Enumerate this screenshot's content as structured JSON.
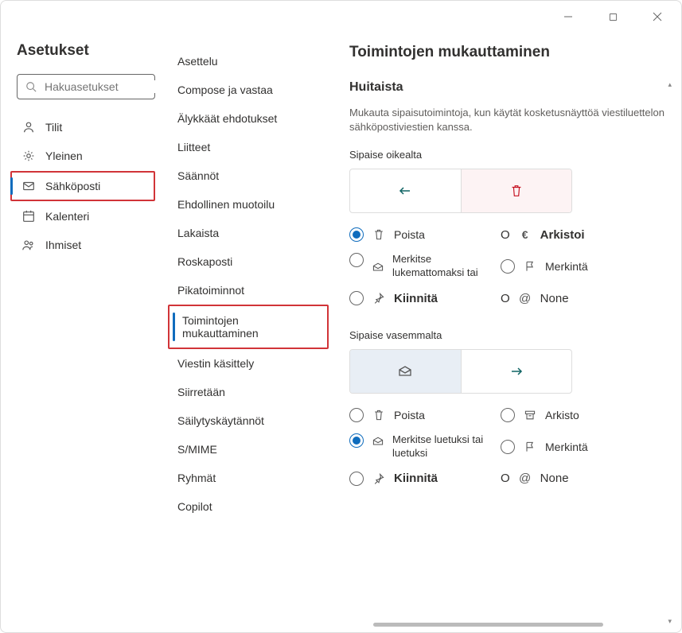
{
  "sidebar": {
    "title": "Asetukset",
    "search_placeholder": "Hakuasetukset",
    "items": [
      {
        "label": "Tilit"
      },
      {
        "label": "Yleinen"
      },
      {
        "label": "Sähköposti"
      },
      {
        "label": "Kalenteri"
      },
      {
        "label": "Ihmiset"
      }
    ]
  },
  "subnav": {
    "items": [
      {
        "label": "Asettelu"
      },
      {
        "label": "Compose ja vastaa"
      },
      {
        "label": "Älykkäät ehdotukset"
      },
      {
        "label": "Liitteet"
      },
      {
        "label": "Säännöt"
      },
      {
        "label": "Ehdollinen muotoilu"
      },
      {
        "label": "Lakaista"
      },
      {
        "label": "Roskaposti"
      },
      {
        "label": "Pikatoiminnot"
      },
      {
        "label": "Toimintojen mukauttaminen"
      },
      {
        "label": "Viestin käsittely"
      },
      {
        "label": "Siirretään"
      },
      {
        "label": "Säilytyskäytännöt"
      },
      {
        "label": "S/MIME"
      },
      {
        "label": "Ryhmät"
      },
      {
        "label": "Copilot"
      }
    ]
  },
  "main": {
    "title": "Toimintojen mukauttaminen",
    "section_title": "Huitaista",
    "description": "Mukauta sipaisutoimintoja, kun käytät kosketusnäyttöä viestiluettelon sähköpostiviestien kanssa.",
    "swipe_right": {
      "label": "Sipaise oikealta",
      "options": [
        {
          "label": "Poista",
          "icon": "trash",
          "checked": true
        },
        {
          "label": "Arkistoi",
          "icon": "euro",
          "bold": true
        },
        {
          "label": "Merkitse lukemattomaksi tai",
          "icon": "mail",
          "small": true
        },
        {
          "label": "Merkintä",
          "icon": "flag"
        },
        {
          "label": "Kiinnitä",
          "icon": "pin",
          "bold": true
        },
        {
          "label": "None",
          "icon": "at"
        }
      ]
    },
    "swipe_left": {
      "label": "Sipaise vasemmalta",
      "options": [
        {
          "label": "Poista",
          "icon": "trash"
        },
        {
          "label": "Arkisto",
          "icon": "archive"
        },
        {
          "label": "Merkitse luetuksi tai luetuksi",
          "icon": "mail",
          "small": true,
          "checked": true
        },
        {
          "label": "Merkintä",
          "icon": "flag"
        },
        {
          "label": "Kiinnitä",
          "icon": "pin",
          "bold": true
        },
        {
          "label": "None",
          "icon": "at"
        }
      ]
    }
  }
}
